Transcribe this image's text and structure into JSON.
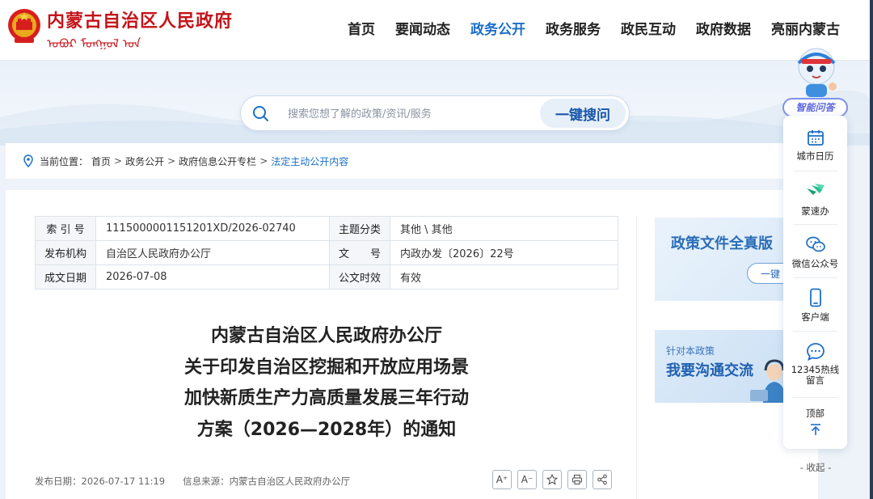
{
  "header": {
    "site_title": "内蒙古自治区人民政府",
    "site_subtitle": "ᠥᠪᠦᠷ ᠮᠣᠩᠭᠣᠯ",
    "nav": [
      {
        "label": "首页",
        "active": false
      },
      {
        "label": "要闻动态",
        "active": false
      },
      {
        "label": "政务公开",
        "active": true
      },
      {
        "label": "政务服务",
        "active": false
      },
      {
        "label": "政民互动",
        "active": false
      },
      {
        "label": "政府数据",
        "active": false
      },
      {
        "label": "亮丽内蒙古",
        "active": false
      }
    ]
  },
  "search": {
    "placeholder": "搜索您想了解的政策/资讯/服务",
    "button": "一键搜问"
  },
  "breadcrumb": {
    "prefix": "当前位置：",
    "items": [
      "首页",
      "政务公开",
      "政府信息公开专栏"
    ],
    "separator": ">",
    "current": "法定主动公开内容"
  },
  "meta": {
    "index_label": "索 引 号",
    "index_value": "1115000001151201XD/2026-02740",
    "topic_label": "主题分类",
    "topic_value": "其他 \\ 其他",
    "org_label": "发布机构",
    "org_value": "自治区人民政府办公厅",
    "docno_label": "文　　号",
    "docno_value": "内政办发〔2026〕22号",
    "date_label": "成文日期",
    "date_value": "2026-07-08",
    "valid_label": "公文时效",
    "valid_value": "有效"
  },
  "document": {
    "title_lines": [
      "内蒙古自治区人民政府办公厅",
      "关于印发自治区挖掘和开放应用场景",
      "加快新质生产力高质量发展三年行动",
      "方案（2026—2028年）的通知"
    ],
    "publish_date": "发布日期：2026-07-17 11:19",
    "source": "信息来源：内蒙古自治区人民政府办公厅"
  },
  "tools": {
    "font_larger": "A⁺",
    "font_smaller": "A⁻"
  },
  "promos": {
    "promo1_title": "政策文件全真版",
    "promo1_button": "一键",
    "promo2_sub": "针对本政策",
    "promo2_title": "我要沟通交流"
  },
  "float_panel": {
    "label": "智能问答",
    "items": [
      {
        "label": "城市日历",
        "icon": "calendar-icon"
      },
      {
        "label": "蒙速办",
        "icon": "mengsuban-icon"
      },
      {
        "label": "微信公众号",
        "icon": "wechat-icon"
      },
      {
        "label": "客户端",
        "icon": "phone-icon"
      },
      {
        "label": "12345热线留言",
        "icon": "chat-icon"
      }
    ],
    "top_label": "顶部",
    "collapse": "- 收起 -"
  },
  "colors": {
    "brand_red": "#c4141a",
    "accent_blue": "#1b6fc8",
    "panel_purple": "#6068e0"
  }
}
